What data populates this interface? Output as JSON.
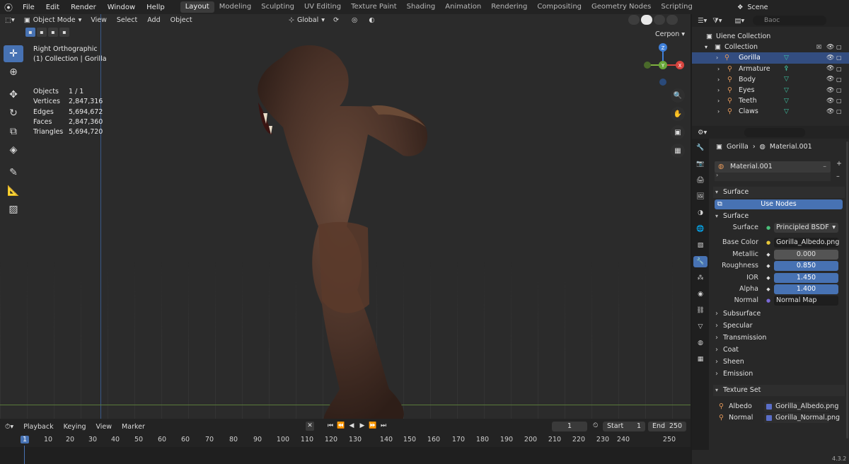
{
  "menubar": {
    "items": [
      "File",
      "Edit",
      "Render",
      "Window",
      "Hellp"
    ],
    "workspaces": [
      "Layout",
      "Modeling",
      "Sculpting",
      "UV Editing",
      "Texture Paint",
      "Shading",
      "Animation",
      "Rendering",
      "Compositing",
      "Geometry Nodes",
      "Scripting"
    ],
    "active_workspace": "Layout",
    "scene": "Scene"
  },
  "viewport": {
    "mode": "Object Mode",
    "menu": [
      "View",
      "Select",
      "Add",
      "Object"
    ],
    "orientation": "Global",
    "view_name": "Right Orthographic",
    "collection_line": "(1) Collection | Gorilla",
    "overlay_label": "Cerpon",
    "stats": [
      {
        "label": "Objects",
        "value": "1 / 1"
      },
      {
        "label": "Vertices",
        "value": "2,847,316"
      },
      {
        "label": "Edges",
        "value": "5,694,672"
      },
      {
        "label": "Faces",
        "value": "2,847,360"
      },
      {
        "label": "Triangles",
        "value": "5,694,720"
      }
    ],
    "gizmo": {
      "x": "X",
      "y": "Y",
      "z": "Z"
    }
  },
  "timeline": {
    "menu": [
      "Playback",
      "Keying",
      "View",
      "Marker"
    ],
    "current_frame": "1",
    "start_label": "Start",
    "start": "1",
    "end_label": "End",
    "end": "250",
    "ruler": [
      "1",
      "10",
      "20",
      "30",
      "40",
      "50",
      "60",
      "60",
      "70",
      "80",
      "90",
      "100",
      "110",
      "120",
      "130",
      "140",
      "150",
      "160",
      "170",
      "180",
      "190",
      "200",
      "210",
      "220",
      "230",
      "240",
      "250"
    ]
  },
  "outliner": {
    "search_placeholder": "Вaoc",
    "rows": [
      {
        "name": "Uiene Collection",
        "level": 0
      },
      {
        "name": "Collection",
        "level": 1
      },
      {
        "name": "Gorilla",
        "level": 2,
        "selected": true
      },
      {
        "name": "Armature",
        "level": 2
      },
      {
        "name": "Body",
        "level": 2
      },
      {
        "name": "Eyes",
        "level": 2
      },
      {
        "name": "Teeth",
        "level": 2
      },
      {
        "name": "Claws",
        "level": 2
      }
    ]
  },
  "properties": {
    "object": "Gorilla",
    "material": "Material.001",
    "slot": "Material.001",
    "surface_panel": "Surface",
    "use_nodes": "Use Nodes",
    "surface_sub": "Surface",
    "fields": [
      {
        "label": "Surface",
        "value": "Principled BSDF",
        "kind": "sel"
      },
      {
        "label": "Base Color",
        "value": "Gorilla_Albedo.png",
        "kind": "tex"
      },
      {
        "label": "Metallic",
        "value": "0.000",
        "kind": "num"
      },
      {
        "label": "Roughness",
        "value": "0.850",
        "kind": "blue"
      },
      {
        "label": "IOR",
        "value": "1.450",
        "kind": "blue"
      },
      {
        "label": "Alpha",
        "value": "1.400",
        "kind": "blue"
      },
      {
        "label": "Normal",
        "value": "Normal Map",
        "kind": "tex"
      }
    ],
    "collapsed": [
      "Subsurface",
      "Specular",
      "Transmission",
      "Coat",
      "Sheen",
      "Emission"
    ],
    "texture_set": "Texture Set",
    "textures": [
      {
        "label": "Albedo",
        "file": "Gorilla_Albedo.png"
      },
      {
        "label": "Normal",
        "file": "Gorilla_Normal.png"
      }
    ]
  },
  "version": "4.3.2",
  "colors": {
    "accent": "#4772b3",
    "selected_row": "#334d80"
  }
}
